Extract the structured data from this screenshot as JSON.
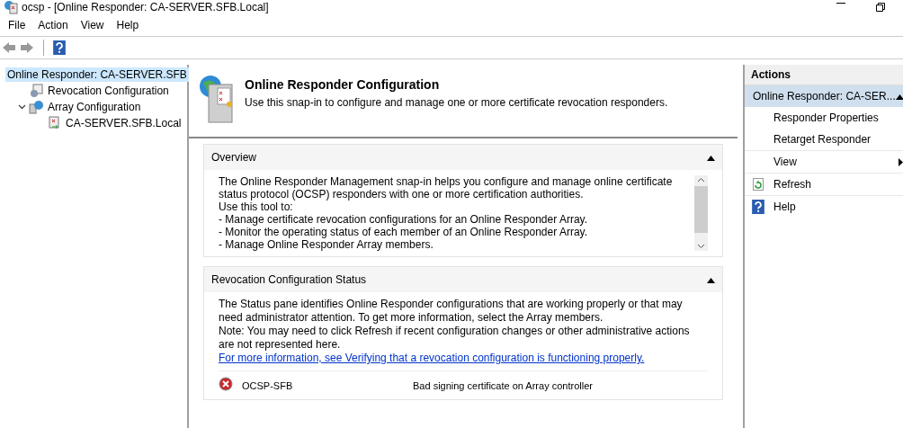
{
  "window": {
    "title": "ocsp - [Online Responder: CA-SERVER.SFB.Local]"
  },
  "menu": [
    "File",
    "Action",
    "View",
    "Help"
  ],
  "tree": [
    {
      "label": "Online Responder: CA-SERVER.SFB",
      "selected": true,
      "kind": "responder",
      "children": [
        {
          "label": "Revocation Configuration",
          "selected": false,
          "kind": "revocation"
        },
        {
          "label": "Array Configuration",
          "selected": false,
          "kind": "array",
          "expanded": true,
          "children": [
            {
              "label": "CA-SERVER.SFB.Local",
              "selected": false,
              "kind": "server"
            }
          ]
        }
      ]
    }
  ],
  "header": {
    "title": "Online Responder Configuration",
    "subtitle": "Use this snap-in to configure and manage one or more certificate revocation responders."
  },
  "overview": {
    "title": "Overview",
    "expanded": true,
    "lines": [
      "The Online Responder Management snap-in helps you configure and manage online certificate status protocol (OCSP) responders with one or more certification authorities.",
      "Use this tool to:",
      "-  Manage certificate revocation configurations for an Online Responder Array.",
      "-  Monitor the operating status of each member of an Online Responder Array.",
      "-  Manage Online Responder Array members."
    ]
  },
  "revocation_status": {
    "title": "Revocation Configuration Status",
    "expanded": true,
    "paragraphs": [
      "The Status pane identifies Online Responder configurations that are working properly or that may need administrator attention. To get more information, select the Array members.",
      "Note: You may need to click Refresh if recent configuration changes or other administrative actions are not represented here."
    ],
    "link": "For more information, see Verifying that a revocation configuration is functioning properly.",
    "rows": [
      {
        "name": "OCSP-SFB",
        "message": "Bad signing certificate on Array controller",
        "kind": "error"
      }
    ]
  },
  "actions": {
    "title": "Actions",
    "section": {
      "label": "Online Responder: CA-SER...",
      "expanded": true
    },
    "items": [
      {
        "label": "Responder Properties",
        "kind": "plain"
      },
      {
        "label": "Retarget Responder",
        "kind": "plain"
      },
      {
        "label": "View",
        "kind": "submenu"
      },
      {
        "label": "Refresh",
        "kind": "refresh"
      },
      {
        "label": "Help",
        "kind": "help"
      }
    ]
  }
}
